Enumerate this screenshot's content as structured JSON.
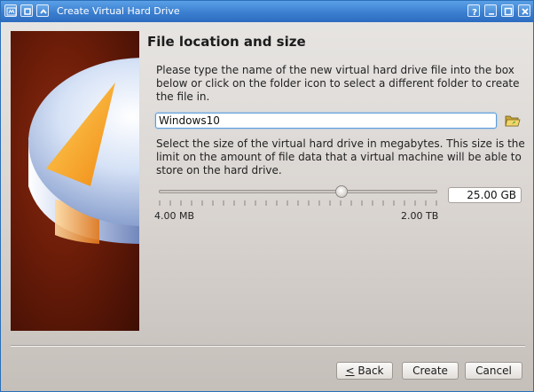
{
  "window": {
    "title": "Create Virtual Hard Drive"
  },
  "page": {
    "heading": "File location and size",
    "location_description": "Please type the name of the new virtual hard drive file into the box below or click on the folder icon to select a different folder to create the file in.",
    "size_description": "Select the size of the virtual hard drive in megabytes. This size is the limit on the amount of file data that a virtual machine will be able to store on the hard drive."
  },
  "location": {
    "value": "Windows10",
    "folder_icon": "folder-open-icon"
  },
  "size": {
    "value": "25.00 GB",
    "slider_fraction": 0.655,
    "min_label": "4.00 MB",
    "max_label": "2.00 TB"
  },
  "buttons": {
    "back_mnemonic": "<",
    "back_rest": " Back",
    "create": "Create",
    "cancel": "Cancel"
  },
  "titlebar_icons": [
    "app-icon",
    "restore-icon",
    "chevron-up-icon",
    "help-icon",
    "minimize-icon",
    "maximize-icon",
    "close-icon"
  ],
  "colors": {
    "titlebar": "#3b7fd0",
    "focus_border": "#5a9cd8",
    "banner": "#6a1c08"
  }
}
